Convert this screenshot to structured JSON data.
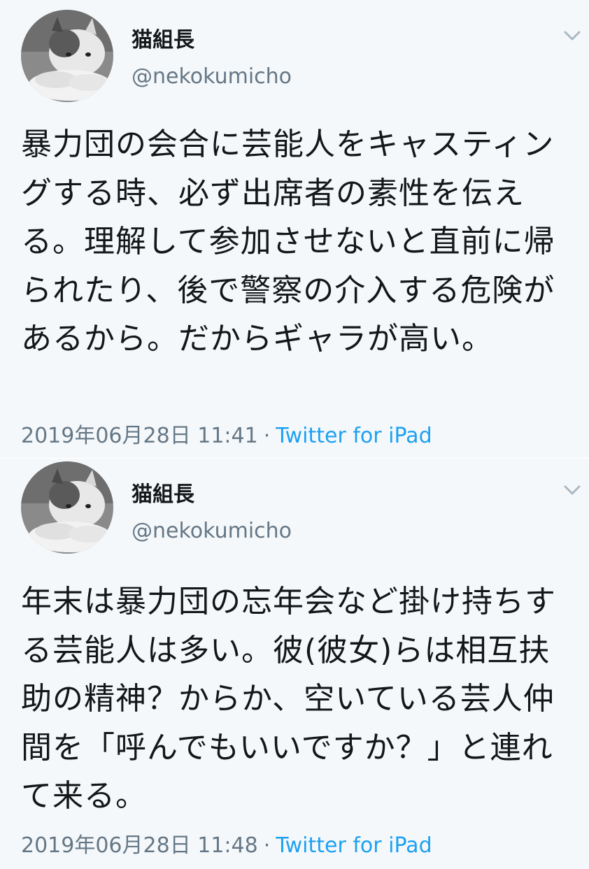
{
  "tweets": [
    {
      "display_name": "猫組長",
      "handle": "@nekokumicho",
      "text": "暴力団の会合に芸能人をキャスティングする時、必ず出席者の素性を伝える。理解して参加させないと直前に帰られたり、後で警察の介入する危険があるから。だからギャラが高い。",
      "timestamp": "2019年06月28日 11:41",
      "separator": "·",
      "source": "Twitter for iPad",
      "menu_icon": "chevron-down-icon"
    },
    {
      "display_name": "猫組長",
      "handle": "@nekokumicho",
      "text": "年末は暴力団の忘年会など掛け持ちする芸能人は多い。彼(彼女)らは相互扶助の精神？からか、空いている芸人仲間を「呼んでもいいですか？」と連れて来る。",
      "timestamp": "2019年06月28日 11:48",
      "separator": "·",
      "source": "Twitter for iPad",
      "menu_icon": "chevron-down-icon"
    }
  ],
  "colors": {
    "background": "#f5f8fa",
    "text": "#14171a",
    "secondary_text": "#657786",
    "link": "#1da1f2"
  }
}
